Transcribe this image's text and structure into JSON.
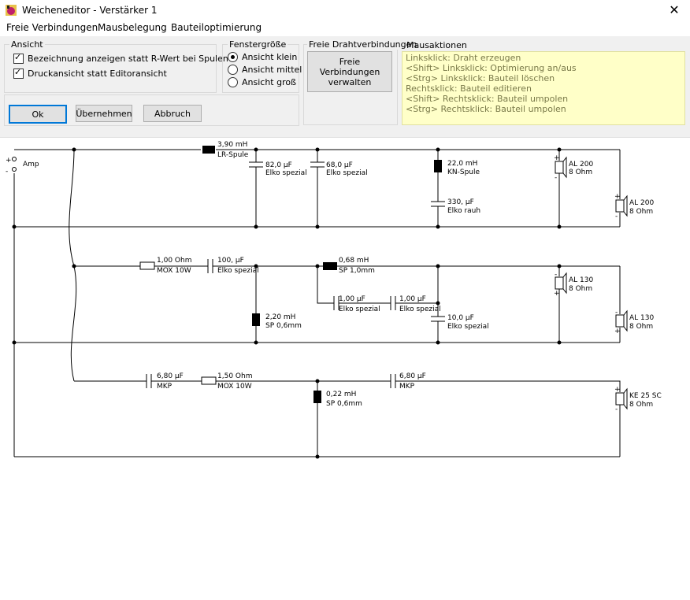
{
  "window": {
    "title": "Weicheneditor - Verstärker 1",
    "close": "✕"
  },
  "menu": [
    "Freie Verbindungen",
    "Mausbelegung",
    "Bauteiloptimierung"
  ],
  "ansicht": {
    "label": "Ansicht",
    "checkbox1": "Bezeichnung anzeigen statt R-Wert bei Spulen",
    "checkbox2": "Druckansicht statt Editoransicht"
  },
  "fenstergroesse": {
    "label": "Fenstergröße",
    "options": [
      "Ansicht klein",
      "Ansicht mittel",
      "Ansicht groß"
    ],
    "selected": "Ansicht klein"
  },
  "buttons": {
    "ok": "Ok",
    "apply": "Übernehmen",
    "cancel": "Abbruch"
  },
  "freie": {
    "label": "Freie Drahtverbindungen",
    "button_line1": "Freie Verbindungen",
    "button_line2": "verwalten"
  },
  "mausaktionen": {
    "label": "Mausaktionen",
    "lines": [
      "Linksklick: Draht erzeugen",
      " <Shift> Linksklick: Optimierung an/aus",
      " <Strg> Linksklick: Bauteil löschen",
      "Rechtsklick: Bauteil editieren",
      " <Shift> Rechtsklick: Bauteil umpolen",
      " <Strg> Rechtsklick: Bauteil umpolen"
    ]
  },
  "circuit": {
    "amp": "Amp",
    "plus": "+",
    "minus": "-",
    "c1": {
      "top": "3,90 mH",
      "bottom": "LR-Spule"
    },
    "c2": {
      "top": "82,0 µF",
      "bottom": "Elko spezial"
    },
    "c3": {
      "top": "68,0 µF",
      "bottom": "Elko spezial"
    },
    "c4": {
      "top": "22,0 mH",
      "bottom": "KN-Spule"
    },
    "c5": {
      "top": "330, µF",
      "bottom": "Elko rauh"
    },
    "s1": {
      "top": "AL 200",
      "bottom": "8 Ohm"
    },
    "s2": {
      "top": "AL 200",
      "bottom": "8 Ohm"
    },
    "c6": {
      "top": "1,00 Ohm",
      "bottom": "MOX 10W"
    },
    "c7": {
      "top": "100, µF",
      "bottom": "Elko spezial"
    },
    "c8": {
      "top": "0,68 mH",
      "bottom": "SP 1,0mm"
    },
    "c9": {
      "top": "1,00 µF",
      "bottom": "Elko spezial"
    },
    "c10": {
      "top": "1,00 µF",
      "bottom": "Elko spezial"
    },
    "c11": {
      "top": "2,20 mH",
      "bottom": "SP 0,6mm"
    },
    "c12": {
      "top": "10,0 µF",
      "bottom": "Elko spezial"
    },
    "s3": {
      "top": "AL 130",
      "bottom": "8 Ohm"
    },
    "s4": {
      "top": "AL 130",
      "bottom": "8 Ohm"
    },
    "c13": {
      "top": "6,80 µF",
      "bottom": "MKP"
    },
    "c14": {
      "top": "1,50 Ohm",
      "bottom": "MOX 10W"
    },
    "c15": {
      "top": "0,22 mH",
      "bottom": "SP 0,6mm"
    },
    "c16": {
      "top": "6,80 µF",
      "bottom": "MKP"
    },
    "s5": {
      "top": "KE 25 SC",
      "bottom": "8 Ohm"
    }
  }
}
